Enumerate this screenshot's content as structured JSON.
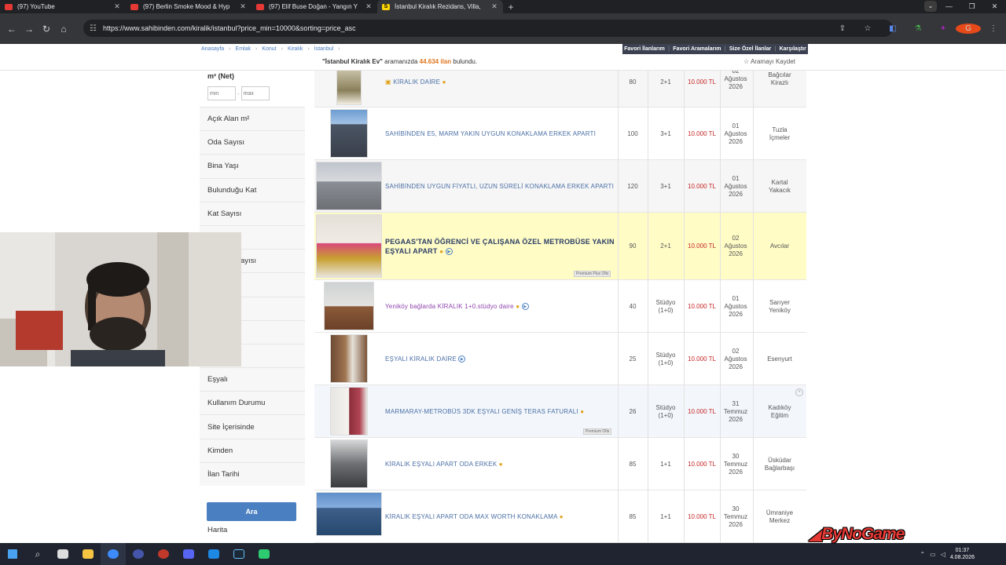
{
  "browser": {
    "tabs": [
      {
        "title": "(97) YouTube",
        "favicon": "youtube-icon",
        "active": false
      },
      {
        "title": "(97) Berlin Smoke Mood & Hyp",
        "favicon": "youtube-icon",
        "active": false
      },
      {
        "title": "(97) Elif Buse Doğan - Yangın Y",
        "favicon": "youtube-icon",
        "active": false
      },
      {
        "title": "İstanbul Kiralık Rezidans, Villa, ",
        "favicon": "sahibinden-icon",
        "active": true
      }
    ],
    "url": "https://www.sahibinden.com/kiralik/istanbul?price_min=10000&sorting=price_asc",
    "profile_initial": "G"
  },
  "site": {
    "breadcrumb": [
      "Anasayfa",
      "Emlak",
      "Konut",
      "Kiralık",
      "İstanbul"
    ],
    "top_links": [
      "Favori İlanlarım",
      "Favori Aramalarım",
      "Size Özel İlanlar",
      "Karşılaştır"
    ],
    "result_query": "\"İstanbul Kiralık Ev\"",
    "result_mid": " aramanızda ",
    "result_count": "44.634 ilan",
    "result_suffix": " bulundu.",
    "save_search": "Aramayı Kaydet"
  },
  "filters": {
    "area_title": "m² (Net)",
    "min_placeholder": "min",
    "max_placeholder": "max",
    "items": [
      "Açık Alan m²",
      "Oda Sayısı",
      "Bina Yaşı",
      "Bulunduğu Kat",
      "Kat Sayısı",
      "",
      "Banyo Sayısı",
      "",
      "",
      "",
      "",
      "Eşyalı",
      "Kullanım Durumu",
      "Site İçerisinde",
      "Kimden",
      "İlan Tarihi"
    ],
    "visible_fragments": {
      "banyo": "ayısı"
    },
    "search_button": "Ara",
    "map_label": "Harita"
  },
  "listings": [
    {
      "title": "KİRALIK DAİRE",
      "m2": "80",
      "rooms": "2+1",
      "price": "10.000 TL",
      "date": [
        "02",
        "Ağustos",
        "2026"
      ],
      "location": [
        "Bağcılar",
        "Kirazlı"
      ]
    },
    {
      "title": "SAHİBİNDEN E5, MARM YAKIN UYGUN KONAKLAMA ERKEK APARTI",
      "m2": "100",
      "rooms": "3+1",
      "price": "10.000 TL",
      "date": [
        "01",
        "Ağustos",
        "2026"
      ],
      "location": [
        "Tuzla",
        "İçmeler"
      ]
    },
    {
      "title": "SAHİBİNDEN UYGUN FİYATLI, UZUN SÜRELİ KONAKLAMA ERKEK APARTI",
      "m2": "120",
      "rooms": "3+1",
      "price": "10.000 TL",
      "date": [
        "01",
        "Ağustos",
        "2026"
      ],
      "location": [
        "Kartal",
        "Yakacık"
      ]
    },
    {
      "title": "PEGAAS'TAN ÖĞRENCİ VE ÇALIŞANA ÖZEL METROBÜSE YAKIN EŞYALI APART",
      "m2": "90",
      "rooms": "2+1",
      "price": "10.000 TL",
      "date": [
        "02",
        "Ağustos",
        "2026"
      ],
      "location": [
        "Avcılar",
        ""
      ],
      "badge": "Premium Plus Ofis"
    },
    {
      "title": "Yeniköy bağlarda KİRALIK 1+0.stüdyo daire",
      "m2": "40",
      "rooms": "Stüdyo (1+0)",
      "price": "10.000 TL",
      "date": [
        "01",
        "Ağustos",
        "2026"
      ],
      "location": [
        "Sarıyer",
        "Yeniköy"
      ]
    },
    {
      "title": "EŞYALI KİRALIK DAİRE",
      "m2": "25",
      "rooms": "Stüdyo (1+0)",
      "price": "10.000 TL",
      "date": [
        "02",
        "Ağustos",
        "2026"
      ],
      "location": [
        "Esenyurt",
        ""
      ]
    },
    {
      "title": "MARMARAY-METROBÜS 3DK EŞYALI GENİŞ TERAS FATURALI",
      "m2": "26",
      "rooms": "Stüdyo (1+0)",
      "price": "10.000 TL",
      "date": [
        "31",
        "Temmuz",
        "2026"
      ],
      "location": [
        "Kadıköy",
        "Eğitim"
      ],
      "badge": "Premium Ofis"
    },
    {
      "title": "KİRALIK EŞYALI APART ODA ERKEK",
      "m2": "85",
      "rooms": "1+1",
      "price": "10.000 TL",
      "date": [
        "30",
        "Temmuz",
        "2026"
      ],
      "location": [
        "Üsküdar",
        "Bağlarbaşı"
      ]
    },
    {
      "title": "KİRALIK EŞYALI APART ODA MAX WORTH KONAKLAMA",
      "m2": "85",
      "rooms": "1+1",
      "price": "10.000 TL",
      "date": [
        "30",
        "Temmuz",
        "2026"
      ],
      "location": [
        "Ümraniye",
        "Merkez"
      ]
    }
  ],
  "taskbar": {
    "time": "01:37",
    "date": "4.08.2026"
  },
  "watermark": "ByNoGame",
  "colors": {
    "price": "#c62828",
    "accent": "#4a7fc1",
    "highlight": "#fffcc6",
    "count": "#e0751c"
  }
}
